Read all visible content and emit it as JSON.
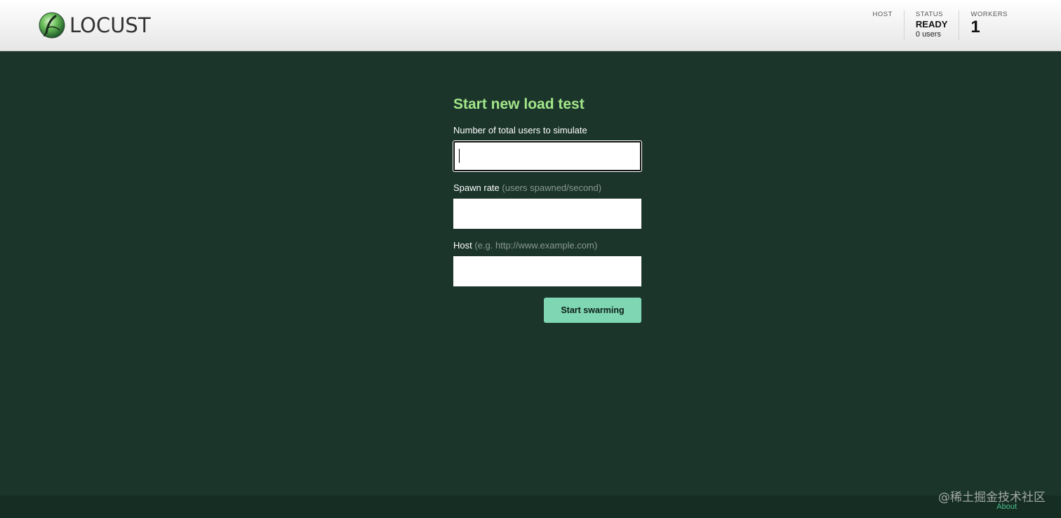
{
  "header": {
    "logo_text": "LOCUST",
    "stats": {
      "host_label": "HOST",
      "status_label": "STATUS",
      "status_value": "READY",
      "status_users": "0 users",
      "workers_label": "WORKERS",
      "workers_value": "1"
    }
  },
  "form": {
    "title": "Start new load test",
    "users_label": "Number of total users to simulate",
    "users_value": "",
    "spawn_label": "Spawn rate",
    "spawn_hint": "(users spawned/second)",
    "spawn_value": "",
    "host_label": "Host",
    "host_hint": "(e.g. http://www.example.com)",
    "host_value": "",
    "submit_label": "Start swarming"
  },
  "footer": {
    "about_label": "About",
    "watermark": "@稀土掘金技术社区"
  },
  "colors": {
    "page_bg": "#1b352b",
    "title": "#a3e689",
    "button": "#7fd6b3",
    "link": "#4fbf8f"
  },
  "icons": {
    "logo": "locust-logo-icon"
  }
}
